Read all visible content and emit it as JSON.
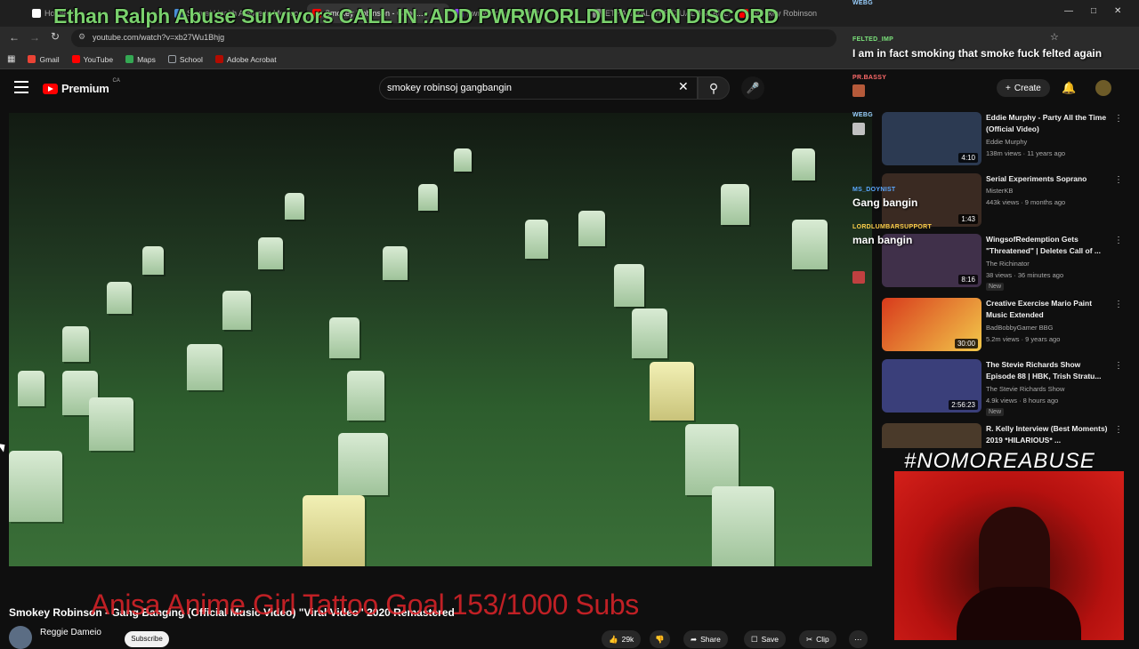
{
  "browser": {
    "tabs": [
      {
        "label": "Home / X"
      },
      {
        "label": "Sexual Health Advice in Mexico"
      },
      {
        "label": "Smokey Robinson - Gang..."
      },
      {
        "label": "pwrworldlive - Twitch"
      },
      {
        "label": "ETHAN RALPH SEXUAL ASSAULT"
      },
      {
        "label": "Smokey Robinson"
      }
    ],
    "url": "youtube.com/watch?v=xb27Wu1Bhjg",
    "bookmarks": [
      {
        "label": "Gmail",
        "color": "#ea4335"
      },
      {
        "label": "YouTube",
        "color": "#ff0000"
      },
      {
        "label": "Maps",
        "color": "#34a853"
      },
      {
        "label": "School",
        "color": "#9aa0a6"
      },
      {
        "label": "Adobe Acrobat",
        "color": "#b30b00"
      }
    ]
  },
  "youtube": {
    "logo_text": "Premium",
    "region": "CA",
    "search_value": "smokey robinsoj gangbangin",
    "create_label": "Create",
    "video": {
      "title": "Smokey Robinson - Gang Banging (Official Music Video) \"Viral Video\" 2020 Remastered",
      "channel": "Reggie Dameio",
      "subscribe": "Subscribe",
      "likes": "29k",
      "share": "Share",
      "save": "Save",
      "clip": "Clip"
    },
    "recommendations": [
      {
        "title": "Eddie Murphy - Party All the Time (Official Video)",
        "channel": "Eddie Murphy",
        "meta": "138m views · 11 years ago",
        "duration": "4:10",
        "thumb": "#2c3a52",
        "badge": ""
      },
      {
        "title": "Serial Experiments Soprano",
        "channel": "MisterKB",
        "meta": "443k views · 9 months ago",
        "duration": "1:43",
        "thumb": "#3a2a22",
        "badge": ""
      },
      {
        "title": "WingsofRedemption Gets \"Threatened\" | Deletes Call of ...",
        "channel": "The Richinator",
        "meta": "38 views · 36 minutes ago",
        "duration": "8:16",
        "thumb": "#40304a",
        "badge": "New"
      },
      {
        "title": "Creative Exercise  Mario Paint Music Extended",
        "channel": "BadBobbyGamer BBG",
        "meta": "5.2m views · 9 years ago",
        "duration": "30:00",
        "thumb": "#d83a1c",
        "badge": ""
      },
      {
        "title": "The Stevie Richards Show Episode 88 | HBK, Trish Stratu...",
        "channel": "The Stevie Richards Show",
        "meta": "4.9k views · 8 hours ago",
        "duration": "2:56:23",
        "thumb": "#3a3f7a",
        "badge": "New"
      },
      {
        "title": "R. Kelly Interview (Best Moments) 2019 *HILARIOUS* ...",
        "channel": "",
        "meta": "",
        "duration": "",
        "thumb": "#4a3a2a",
        "badge": ""
      }
    ]
  },
  "stream_overlay": {
    "top_banner": "Ethan Ralph Abuse Survivors CALL IN :ADD PWRWORLDLIVE ON DISCORD",
    "bottom_banner": "Anisa Anime Girl Tattoo Goal 153/1000 Subs",
    "hashtag": "#NOMOREABUSE",
    "chat": [
      {
        "user": "WEBG",
        "message": "",
        "color": "#9ad0ff"
      },
      {
        "user": "FELTED_IMP",
        "message": "I am in fact smoking that smoke fuck felted again",
        "color": "#7be37b"
      },
      {
        "user": "PR.BASSY",
        "message": "",
        "color": "#ff6b6b"
      },
      {
        "user": "WEBG",
        "message": "",
        "color": "#9ad0ff"
      },
      {
        "user": "MS_DOYNIST",
        "message": "Gang bangin",
        "color": "#5aa8ff"
      },
      {
        "user": "LORDLUMBARSUPPORT",
        "message": "man bangin",
        "color": "#ffd04a"
      }
    ]
  }
}
